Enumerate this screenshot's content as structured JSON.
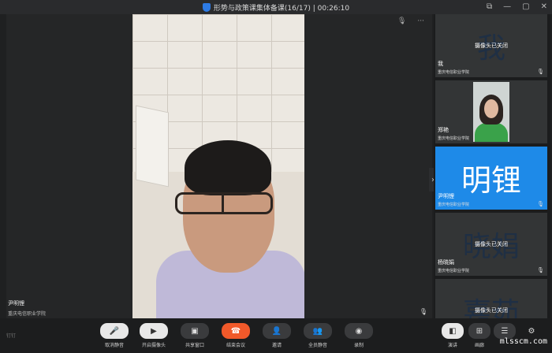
{
  "window": {
    "title": "形势与政策课集体备课(16/17) | 00:26:10"
  },
  "window_controls": {
    "icons": [
      "popout-icon",
      "minimize-icon",
      "maximize-icon",
      "close-icon"
    ]
  },
  "main_video": {
    "name": "尹明锂",
    "org": "重庆电信职业学院",
    "top_icons": [
      "mic-icon",
      "more-icon"
    ],
    "more_label": "···"
  },
  "sidebar": {
    "participants": [
      {
        "big": "我",
        "status": "摄像头已关闭",
        "name": "我",
        "org": "重庆电信职业学院"
      },
      {
        "big": "",
        "status": "",
        "name": "郑艳",
        "org": "重庆电信职业学院"
      },
      {
        "big": "明锂",
        "status": "",
        "name": "尹明锂",
        "org": "重庆电信职业学院"
      },
      {
        "big": "晓娟",
        "status": "摄像头已关闭",
        "name": "杨晓娟",
        "org": "重庆电信职业学院"
      },
      {
        "big": "嘉茹",
        "status": "摄像头已关闭",
        "name": "",
        "org": ""
      }
    ]
  },
  "toolbar": {
    "brand": "钉钉",
    "items": [
      {
        "label": "取消静音",
        "icon": "mic-off-icon"
      },
      {
        "label": "开启摄像头",
        "icon": "camera-icon"
      },
      {
        "label": "共享窗口",
        "icon": "share-icon"
      },
      {
        "label": "结束会议",
        "icon": "hangup-icon"
      },
      {
        "label": "邀请",
        "icon": "invite-icon"
      },
      {
        "label": "全员静音",
        "icon": "mute-all-icon"
      },
      {
        "label": "录制",
        "icon": "record-icon"
      },
      {
        "label": "演讲",
        "icon": "speaker-view-icon"
      },
      {
        "label": "画廊",
        "icon": "gallery-view-icon"
      },
      {
        "label": "",
        "icon": "list-icon"
      },
      {
        "label": "",
        "icon": "settings-icon"
      }
    ],
    "watermark": "mlsscm.com"
  }
}
